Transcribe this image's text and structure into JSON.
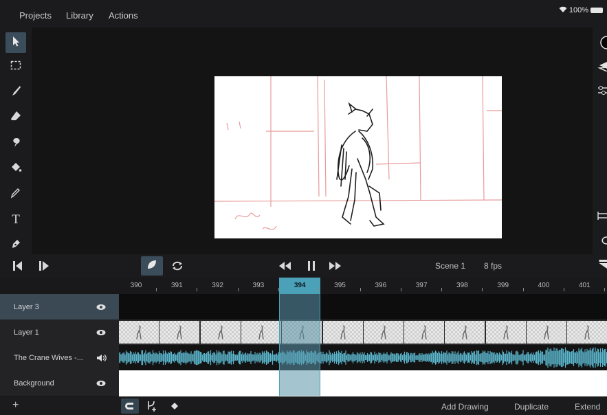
{
  "menu": {
    "projects": "Projects",
    "library": "Library",
    "actions": "Actions"
  },
  "status": {
    "battery": "100%"
  },
  "tools": [
    "select-icon",
    "marquee-icon",
    "brush-icon",
    "eraser-icon",
    "smudge-icon",
    "fill-icon",
    "eyedropper-icon",
    "text-icon",
    "pen-icon"
  ],
  "playback": {
    "scene": "Scene 1",
    "fps": "8 fps"
  },
  "timeline": {
    "frames": [
      "390",
      "391",
      "392",
      "393",
      "394",
      "395",
      "396",
      "397",
      "398",
      "399",
      "400",
      "401"
    ],
    "current_frame": "394",
    "layers": [
      {
        "name": "Layer 3",
        "visibility": "eye-icon"
      },
      {
        "name": "Layer 1",
        "visibility": "eye-icon"
      },
      {
        "name": "The Crane Wives -...",
        "visibility": "speaker-icon"
      },
      {
        "name": "Background",
        "visibility": "eye-icon"
      }
    ]
  },
  "bottom": {
    "add_drawing": "Add Drawing",
    "duplicate": "Duplicate",
    "extend": "Extend",
    "add": "+"
  },
  "colors": {
    "accent": "#4aa1b8",
    "waveform": "#5bb6cc",
    "sketch_guides": "#e58a8a"
  }
}
